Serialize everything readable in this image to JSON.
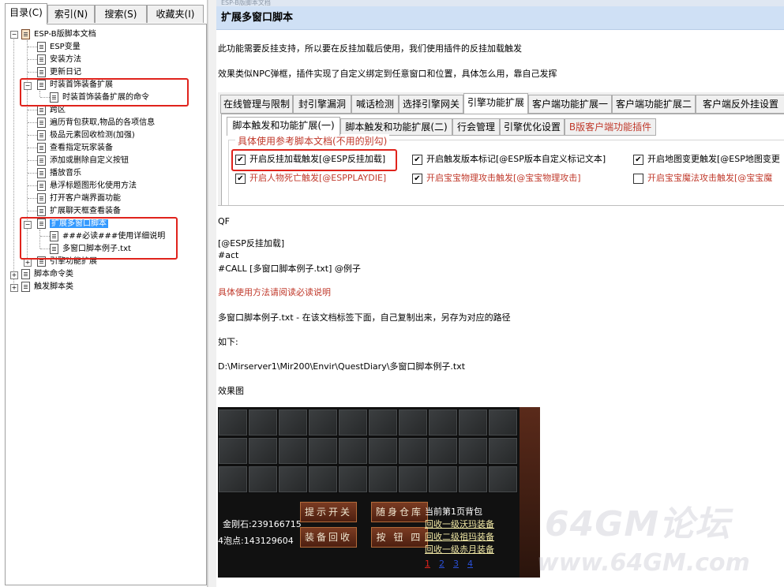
{
  "left_tabs": [
    {
      "label": "目录(C)",
      "active": true
    },
    {
      "label": "索引(N)",
      "active": false
    },
    {
      "label": "搜索(S)",
      "active": false
    },
    {
      "label": "收藏夹(I)",
      "active": false
    }
  ],
  "tree": {
    "root": "ESP-B版脚本文档",
    "items": [
      "ESP变量",
      "安装方法",
      "更新日记",
      "时装首饰装备扩展",
      "时装首饰装备扩展的命令",
      "跨区",
      "遍历背包获取,物品的各项信息",
      "极品元素回收检测(加强)",
      "查看指定玩家装备",
      "添加或删除自定义按钮",
      "播放音乐",
      "悬浮标题图形化使用方法",
      "打开客户端界面功能",
      "扩展聊天框查看装备",
      "扩展多窗口脚本",
      "###必读###使用详细说明",
      "多窗口脚本例子.txt",
      "引擎功能扩展"
    ],
    "bottom": [
      "脚本命令类",
      "触发脚本类"
    ]
  },
  "page": {
    "header_strip": "ESP-B版脚本文档",
    "title": "扩展多窗口脚本",
    "para1": "此功能需要反挂支持，所以要在反挂加载后使用，我们使用插件的反挂加载触发",
    "para2": "效果类似NPC弹框，插件实现了自定义绑定到任意窗口和位置，具体怎么用，靠自己发挥",
    "qf": "QF",
    "code1": "[@ESP反挂加载]",
    "code2": "#act",
    "code3": "#CALL [多窗口脚本例子.txt] @例子",
    "red_note": "具体使用方法请阅读必读说明",
    "para3": "多窗口脚本例子.txt - 在该文档标签下面，自己复制出来，另存为对应的路径",
    "as_below": "如下:",
    "path": "D:\\Mirserver1\\Mir200\\Envir\\QuestDiary\\多窗口脚本例子.txt",
    "effect": "效果图"
  },
  "dialog": {
    "tabs": [
      "在线管理与限制",
      "封引擎漏洞",
      "喊话检测",
      "选择引擎网关",
      "引擎功能扩展",
      "客户端功能扩展一",
      "客户端功能扩展二",
      "客户端反外挂设置"
    ],
    "subtabs": [
      "脚本触发和功能扩展(一)",
      "脚本触发和功能扩展(二)",
      "行会管理",
      "引擎优化设置",
      "B版客户端功能插件"
    ],
    "group_title": "具体使用参考脚本文档(不用的别勾)",
    "checkboxes": [
      {
        "label": "开启反挂加载触发[@ESP反挂加载]",
        "checked": true
      },
      {
        "label": "开启触发版本标记[@ESP版本自定义标记文本]",
        "checked": true
      },
      {
        "label": "开启地图变更触发[@ESP地图变更",
        "checked": true
      },
      {
        "label": "开启人物死亡触发[@ESPPLAYDIE]",
        "checked": true
      },
      {
        "label": "开启宝宝物理攻击触发[@宝宝物理攻击]",
        "checked": true
      },
      {
        "label": "开启宝宝魔法攻击触发[@宝宝魔",
        "checked": false
      }
    ]
  },
  "game": {
    "btn1": "提示开关",
    "btn2": "随身仓库",
    "btn3": "装备回收",
    "btn4": "按 钮 四",
    "page_label": "当前第1页背包",
    "diamond": "金刚石:239166715",
    "bubble": "4泡点:143129604",
    "links": [
      "回收一级沃玛装备",
      "回收二级祖玛装备",
      "回收一级赤月装备"
    ],
    "pages": [
      "1",
      "2",
      "3",
      "4"
    ]
  },
  "watermark": {
    "line1": "64GM论坛",
    "line2": "www.64GM.com"
  },
  "colors": {
    "accent_red": "#e0231c",
    "title_bg": "#cfe0f5",
    "selection": "#3399ff"
  }
}
